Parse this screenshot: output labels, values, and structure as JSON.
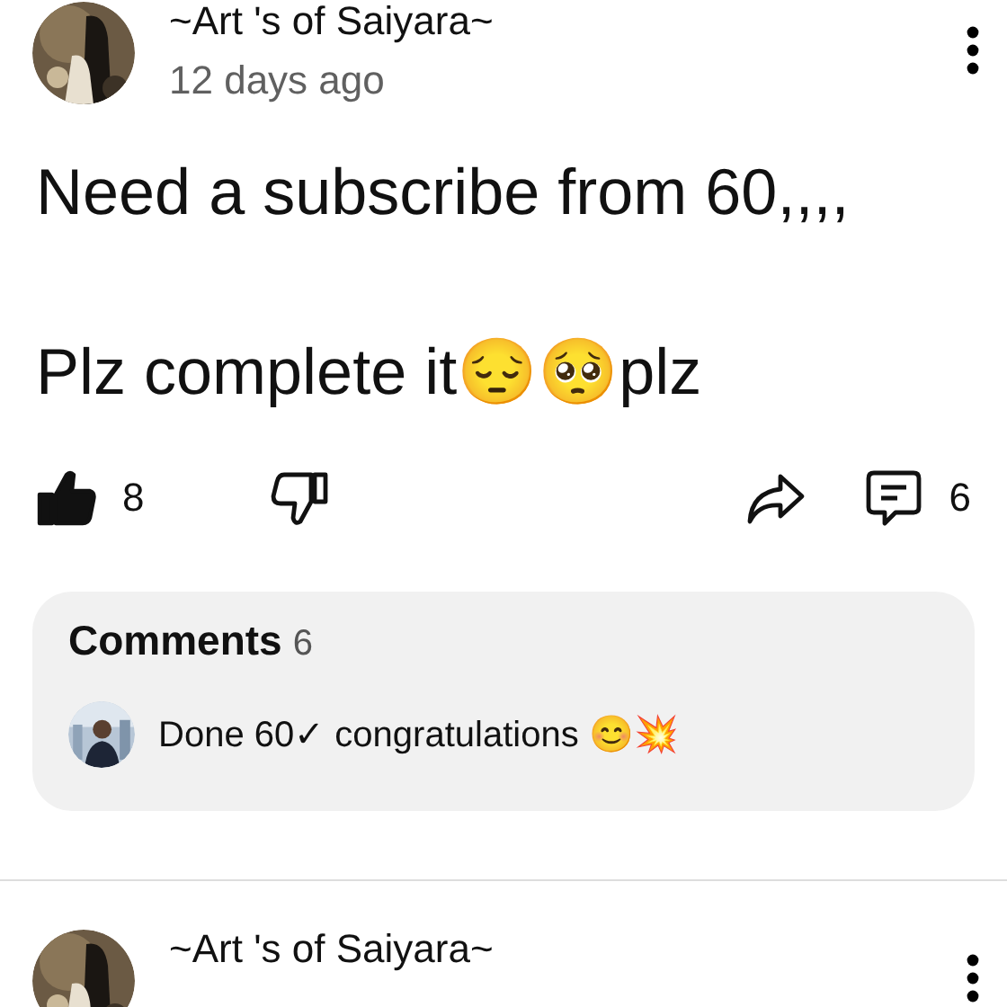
{
  "posts": [
    {
      "author": "~Art 's of Saiyara~",
      "time": "12 days ago",
      "paragraphs": [
        "Need a subscribe from 60,,,,",
        "Plz complete it😔🥺plz"
      ],
      "likes": "8",
      "liked": true,
      "disliked": false,
      "comment_count": "6",
      "comments": {
        "title": "Comments",
        "count": "6",
        "preview": "Done 60✓ congratulations 😊💥"
      }
    },
    {
      "author": "~Art 's of Saiyara~"
    }
  ]
}
